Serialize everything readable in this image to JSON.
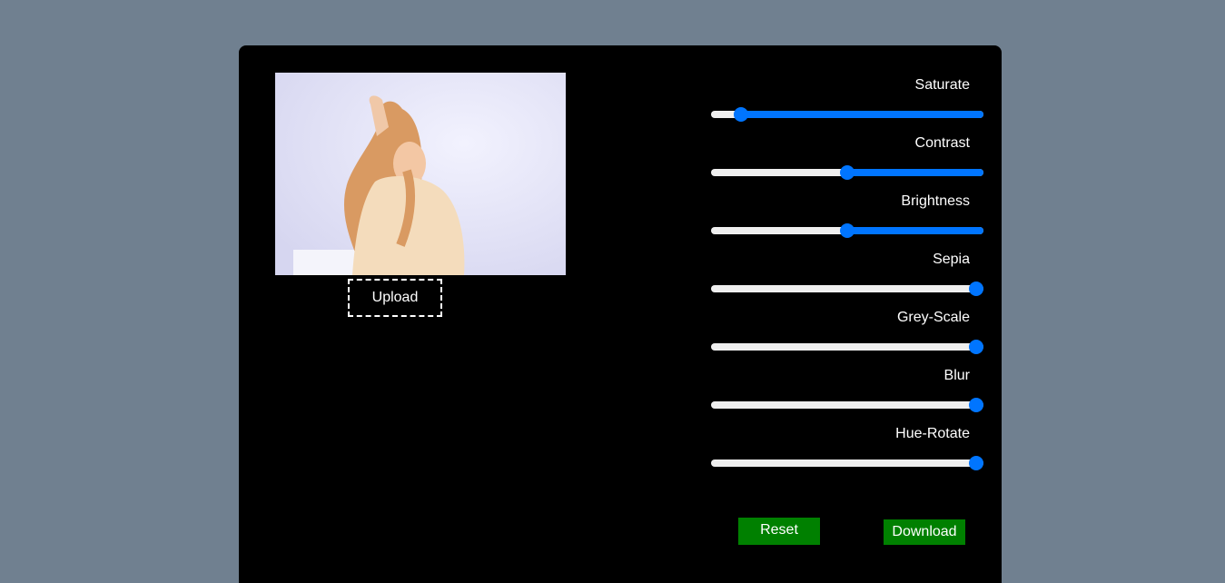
{
  "upload": {
    "label": "Upload"
  },
  "sliders": [
    {
      "label": "Saturate",
      "value": 0.11
    },
    {
      "label": "Contrast",
      "value": 0.5
    },
    {
      "label": "Brightness",
      "value": 0.5
    },
    {
      "label": "Sepia",
      "value": 1.0
    },
    {
      "label": "Grey-Scale",
      "value": 1.0
    },
    {
      "label": "Blur",
      "value": 1.0
    },
    {
      "label": "Hue-Rotate",
      "value": 1.0
    }
  ],
  "actions": {
    "reset_label": "Reset",
    "download_label": "Download"
  },
  "colors": {
    "page_background": "#708090",
    "panel_background": "#000000",
    "slider_accent": "#0075ff",
    "button_green": "#008000"
  }
}
